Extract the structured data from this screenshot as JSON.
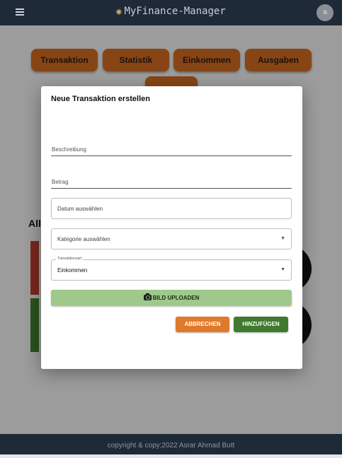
{
  "header": {
    "menu_icon": "hamburger-icon",
    "logo_icon": "piggy-bank-icon",
    "title": "MyFinance-Manager",
    "avatar_initial": "a"
  },
  "nav": {
    "buttons": [
      "Transaktion",
      "Statistik",
      "Einkommen",
      "Ausgaben"
    ],
    "color": "#c8661f"
  },
  "background": {
    "section_title": "All",
    "income_color": "#3e7a2c",
    "expense_color": "#c0392b"
  },
  "dialog": {
    "title": "Neue Transaktion erstellen",
    "description_placeholder": "Beschreibung",
    "amount_placeholder": "Betrag",
    "date_placeholder": "Datum auswählen",
    "category_placeholder": "Kategorie auswählen",
    "type_label": "Transaktionsart",
    "type_value": "Einkommen",
    "upload_label": "BILD UPLOADEN",
    "cancel_label": "ABBRECHEN",
    "add_label": "HINZUFÜGEN",
    "cancel_color": "#e07a2a",
    "add_color": "#3f7a2e",
    "upload_color": "#9ec98a"
  },
  "footer": {
    "text": "copyright & copy;2022 Asrar Ahmad Butt"
  }
}
